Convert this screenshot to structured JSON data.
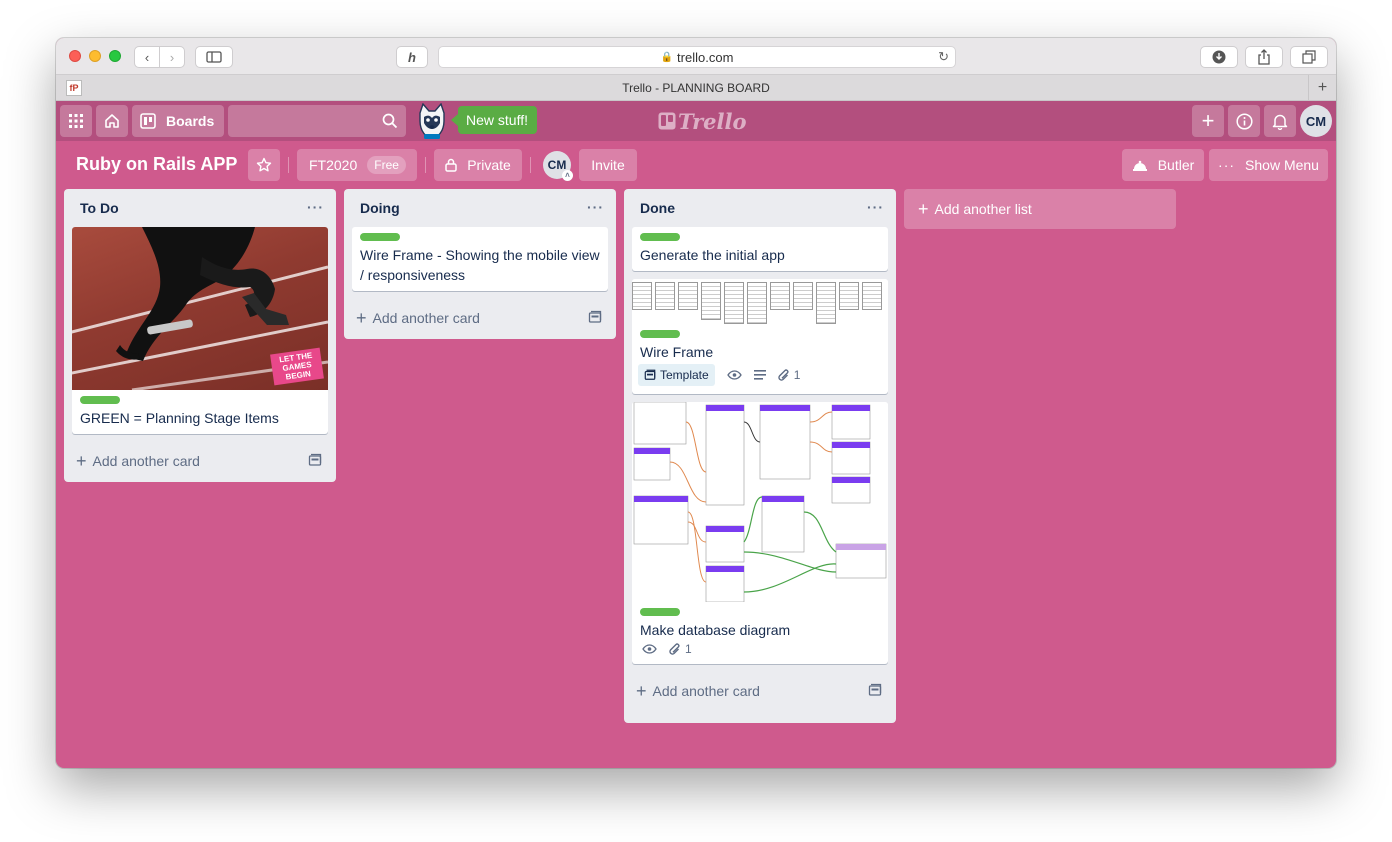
{
  "browser": {
    "url": "trello.com",
    "tab_title": "Trello - PLANNING BOARD",
    "tab_favicon": "fP"
  },
  "topbar": {
    "boards_label": "Boards",
    "new_stuff_label": "New stuff!",
    "logo_text": "Trello",
    "avatar_initials": "CM"
  },
  "board": {
    "title": "Ruby on Rails APP",
    "team": "FT2020",
    "team_badge": "Free",
    "visibility": "Private",
    "member_initials": "CM",
    "invite_label": "Invite",
    "butler_label": "Butler",
    "menu_label": "Show Menu"
  },
  "lists": [
    {
      "title": "To Do",
      "cards": [
        {
          "title": "GREEN = Planning Stage Items",
          "label_color": "#61bd4f",
          "cover": "runner photo",
          "cover_text": "LET THE GAMES BEGIN"
        }
      ],
      "add_card": "Add another card"
    },
    {
      "title": "Doing",
      "cards": [
        {
          "title": "Wire Frame - Showing the mobile view / responsiveness",
          "label_color": "#61bd4f"
        }
      ],
      "add_card": "Add another card"
    },
    {
      "title": "Done",
      "cards": [
        {
          "title": "Generate the initial app",
          "label_color": "#61bd4f"
        },
        {
          "title": "Wire Frame",
          "label_color": "#61bd4f",
          "template_label": "Template",
          "attachments": "1"
        },
        {
          "title": "Make database diagram",
          "label_color": "#61bd4f",
          "attachments": "1"
        }
      ],
      "add_card": "Add another card"
    }
  ],
  "add_list": "Add another list",
  "colors": {
    "board_bg": "#cf5a8d",
    "topbar_bg": "#b34f7e",
    "label_green": "#61bd4f",
    "new_stuff_bg": "#5aac44"
  }
}
